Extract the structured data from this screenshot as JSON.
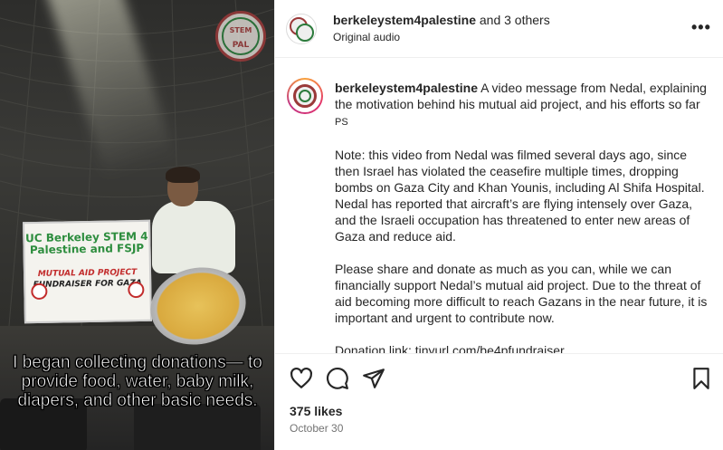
{
  "header": {
    "username": "berkeleystem4palestine",
    "collab_suffix": " and 3 others",
    "audio": "Original audio",
    "more_icon": "more-horizontal-icon"
  },
  "media": {
    "stamp_line1": "STEM",
    "stamp_line2": "PAL",
    "banner_line1": "UC Berkeley STEM 4 Palestine and FSJP",
    "banner_line2": "MUTUAL AID PROJECT",
    "banner_line3": "FUNDRAISER FOR GAZA",
    "caption": "I began collecting donations— to provide food, water, baby milk, diapers, and other basic needs."
  },
  "post": {
    "username": "berkeleystem4palestine",
    "intro": " A video message from Nedal, explaining the motivation behind his mutual aid project, and his efforts so far ",
    "ps": "PS",
    "note": "Note: this video from Nedal was filmed several days ago, since then Israel has violated the ceasefire multiple times, dropping bombs on Gaza City and Khan Younis, including Al Shifa Hospital. Nedal has reported that aircraft’s are flying intensely over Gaza, and the Israeli occupation has threatened to enter new areas of Gaza and reduce aid.",
    "appeal": "Please share and donate as much as you can, while we can financially support Nedal’s mutual aid project. Due to the threat of aid becoming more difficult to reach Gazans in the near future, it is important and urgent to contribute now.",
    "donation_label": "Donation link: ",
    "donation_link": "tinyurl.com/be4pfundraiser"
  },
  "actions": {
    "icons": [
      "heart-icon",
      "comment-icon",
      "share-icon",
      "bookmark-icon"
    ],
    "likes": "375 likes",
    "date": "October 30"
  },
  "colors": {
    "accent_red": "#9a3939",
    "accent_green": "#2b7a3b",
    "text": "#262626",
    "muted": "#737373"
  }
}
